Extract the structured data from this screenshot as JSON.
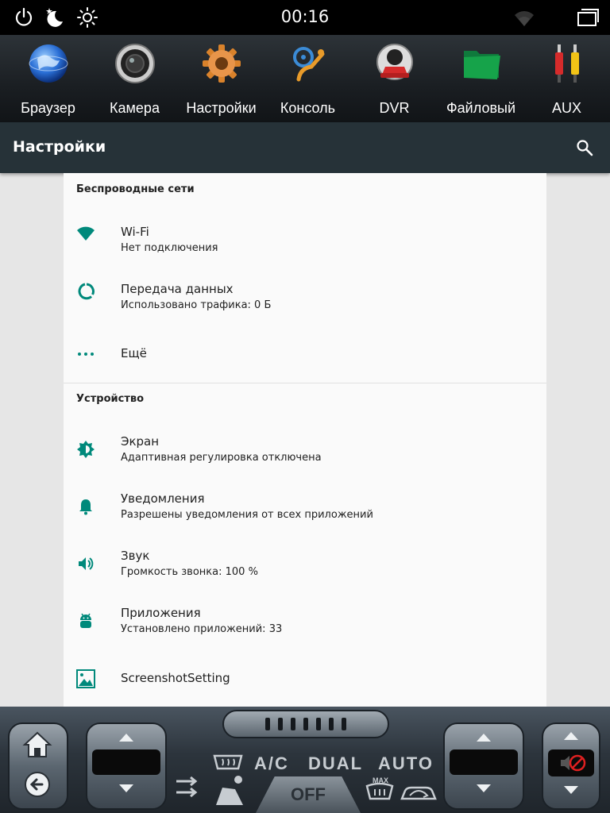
{
  "statusbar": {
    "time": "00:16",
    "icons": [
      "power-icon",
      "night-mode-icon",
      "brightness-icon",
      "wifi-signal-icon",
      "recent-apps-icon"
    ]
  },
  "launcher": {
    "apps": [
      {
        "label": "Браузер",
        "icon": "globe-icon"
      },
      {
        "label": "Камера",
        "icon": "camera-lens-icon"
      },
      {
        "label": "Настройки",
        "icon": "gear-icon"
      },
      {
        "label": "Консоль",
        "icon": "steering-console-icon"
      },
      {
        "label": "DVR",
        "icon": "dvr-car-icon"
      },
      {
        "label": "Файловый",
        "icon": "folder-icon"
      },
      {
        "label": "AUX",
        "icon": "rca-cable-icon"
      }
    ]
  },
  "toolbar": {
    "title": "Настройки",
    "search_icon": "search-icon"
  },
  "colors": {
    "accent": "#00897b",
    "toolbar": "#263238",
    "text": "#212121"
  },
  "sections": [
    {
      "title": "Беспроводные сети",
      "items": [
        {
          "title": "Wi-Fi",
          "subtitle": "Нет подключения",
          "icon": "wifi-icon"
        },
        {
          "title": "Передача данных",
          "subtitle": "Использовано трафика: 0 Б",
          "icon": "data-usage-icon"
        },
        {
          "title": "Ещё",
          "subtitle": "",
          "icon": "more-dots-icon"
        }
      ]
    },
    {
      "title": "Устройство",
      "items": [
        {
          "title": "Экран",
          "subtitle": "Адаптивная регулировка отключена",
          "icon": "display-brightness-icon"
        },
        {
          "title": "Уведомления",
          "subtitle": "Разрешены уведомления от всех приложений",
          "icon": "bell-icon"
        },
        {
          "title": "Звук",
          "subtitle": "Громкость звонка: 100 %",
          "icon": "volume-icon"
        },
        {
          "title": "Приложения",
          "subtitle": "Установлено приложений: 33",
          "icon": "android-icon"
        },
        {
          "title": "ScreenshotSetting",
          "subtitle": "",
          "icon": "screenshot-icon"
        }
      ]
    }
  ],
  "climate": {
    "ac_label": "A/C",
    "dual_label": "DUAL",
    "auto_label": "AUTO",
    "off_label": "OFF",
    "max_label": "MAX"
  }
}
